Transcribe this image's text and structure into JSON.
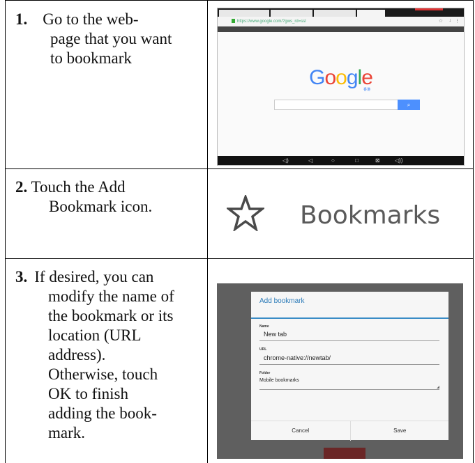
{
  "steps": [
    {
      "num": "1.",
      "lines": [
        "Go to the web-",
        "page that you want",
        "to bookmark"
      ]
    },
    {
      "num": "2.",
      "lines": [
        "Touch the Add",
        "Bookmark icon."
      ]
    },
    {
      "num": "3.",
      "lines": [
        "If desired, you can",
        "modify the name of",
        "the bookmark or its",
        "location (URL",
        "address).",
        "Otherwise, touch",
        "OK to finish",
        "adding the book-",
        "mark."
      ]
    }
  ],
  "browser": {
    "url": "https://www.google.com/?gws_rd=ssl",
    "logo_letters": [
      "G",
      "o",
      "o",
      "g",
      "l",
      "e"
    ],
    "logo_colors": [
      "#4285f4",
      "#ea4335",
      "#fbbc05",
      "#4285f4",
      "#34a853",
      "#ea4335"
    ],
    "sub_label": "香港",
    "search_button_icon": "search-icon"
  },
  "bookmarks_label": "Bookmarks",
  "dialog": {
    "title": "Add bookmark",
    "name_label": "Name",
    "name_value": "New tab",
    "url_label": "URL",
    "url_value": "chrome-native://newtab/",
    "folder_label": "Folder",
    "folder_value": "Mobile bookmarks",
    "cancel_label": "Cancel",
    "save_label": "Save"
  }
}
